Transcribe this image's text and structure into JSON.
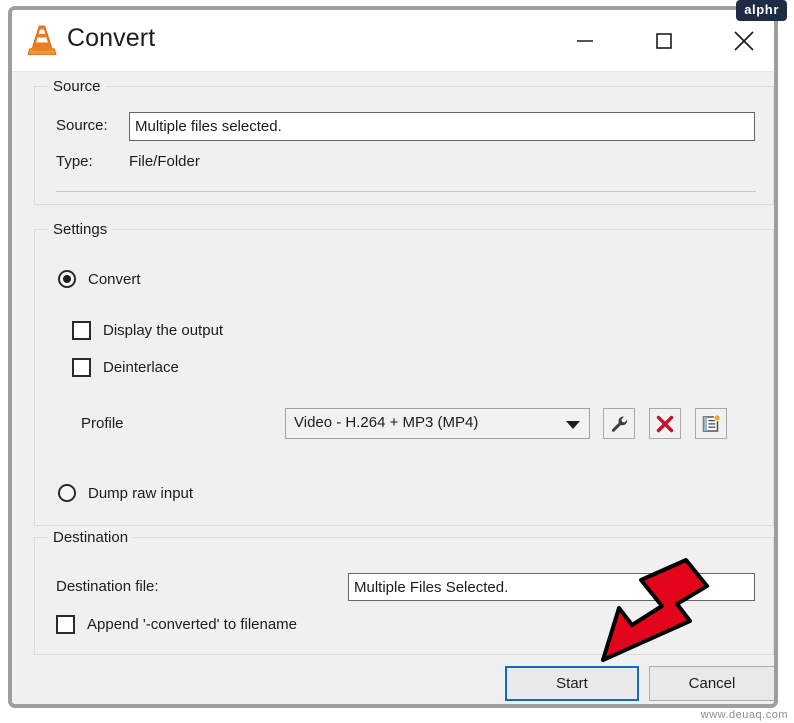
{
  "window": {
    "title": "Convert",
    "app_icon": "vlc-cone-icon",
    "controls": {
      "minimize": "minimize-icon",
      "maximize": "maximize-icon",
      "close": "close-icon"
    }
  },
  "watermarks": {
    "top_right": "alphr",
    "bottom_right": "www.deuaq.com"
  },
  "source": {
    "group_title": "Source",
    "source_label": "Source:",
    "source_value": "Multiple files selected.",
    "source_placeholder": "",
    "type_label": "Type:",
    "type_value": "File/Folder"
  },
  "settings": {
    "group_title": "Settings",
    "convert_radio": {
      "label": "Convert",
      "checked": true
    },
    "display_output_checkbox": {
      "label": "Display the output",
      "checked": false
    },
    "deinterlace_checkbox": {
      "label": "Deinterlace",
      "checked": false
    },
    "profile_label": "Profile",
    "profile_value": "Video - H.264 + MP3 (MP4)",
    "profile_options": [
      "Video - H.264 + MP3 (MP4)"
    ],
    "edit_profile_button": "wrench-icon",
    "delete_profile_button": "red-x-icon",
    "new_profile_button": "new-profile-icon",
    "dump_raw_radio": {
      "label": "Dump raw input",
      "checked": false
    }
  },
  "destination": {
    "group_title": "Destination",
    "destination_label": "Destination file:",
    "destination_value": "Multiple Files Selected.",
    "destination_placeholder": "",
    "append_checkbox": {
      "label": "Append '-converted' to filename",
      "checked": false
    }
  },
  "footer": {
    "start_button": "Start",
    "cancel_button": "Cancel"
  },
  "annotation": {
    "arrow": "red-arrow-pointing-to-start-button"
  },
  "colors": {
    "accent_focus": "#0d6ebf",
    "annotation_red": "#e3051b",
    "delete_red": "#c8102e",
    "watermark_navy": "#1d2b45",
    "window_bg": "#f0f0f0"
  }
}
